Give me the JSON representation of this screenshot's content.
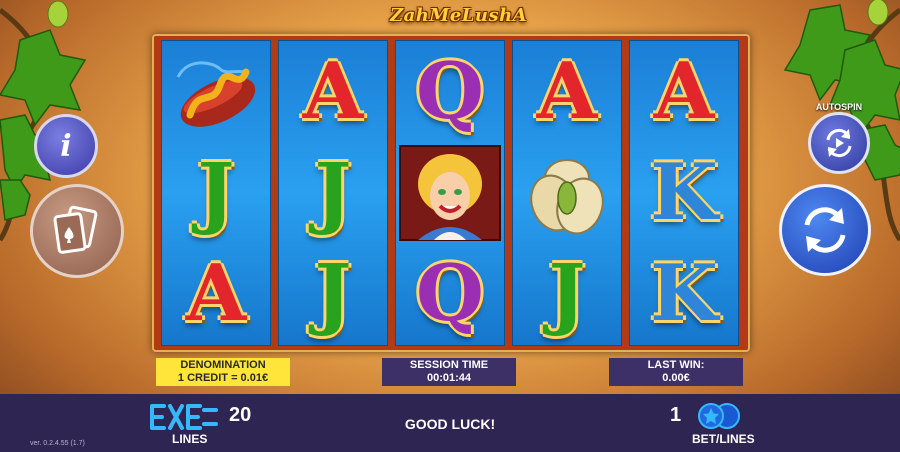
{
  "game": {
    "logo_text": "ZahMeLushA",
    "status_message": "GOOD LUCK!",
    "version": "ver. 0.2.4.55 (1.7)"
  },
  "colors": {
    "bottom_bar": "#2e2552",
    "denomination_bg": "#ffe43a",
    "info_box_bg": "#3d3066",
    "reel_bg": "#2aa0f0",
    "frame": "#b23a16"
  },
  "buttons": {
    "info": {
      "icon": "info-icon",
      "label": "i"
    },
    "gamble": {
      "icon": "playing-cards-icon"
    },
    "autospin": {
      "label": "AUTOSPIN",
      "icon": "autospin-arrows-icon"
    },
    "spin": {
      "icon": "spin-arrows-icon"
    }
  },
  "reels": [
    {
      "symbols": [
        "sausage",
        "J",
        "A"
      ]
    },
    {
      "symbols": [
        "A",
        "J",
        "J"
      ]
    },
    {
      "symbols": [
        "Q",
        "girl",
        "Q"
      ]
    },
    {
      "symbols": [
        "A",
        "pistachio",
        "J"
      ]
    },
    {
      "symbols": [
        "A",
        "K",
        "K"
      ]
    }
  ],
  "info_panels": {
    "denomination": {
      "title": "DENOMINATION",
      "value": "1 CREDIT = 0.01€"
    },
    "session_time": {
      "title": "SESSION TIME",
      "value": "00:01:44"
    },
    "last_win": {
      "title": "LAST WIN:",
      "value": "0.00€"
    }
  },
  "bottom_bar": {
    "lines": {
      "label": "LINES",
      "value": "20",
      "icon": "lines-icon"
    },
    "bet": {
      "label": "BET/LINES",
      "value": "1",
      "icon": "coins-icon"
    }
  }
}
